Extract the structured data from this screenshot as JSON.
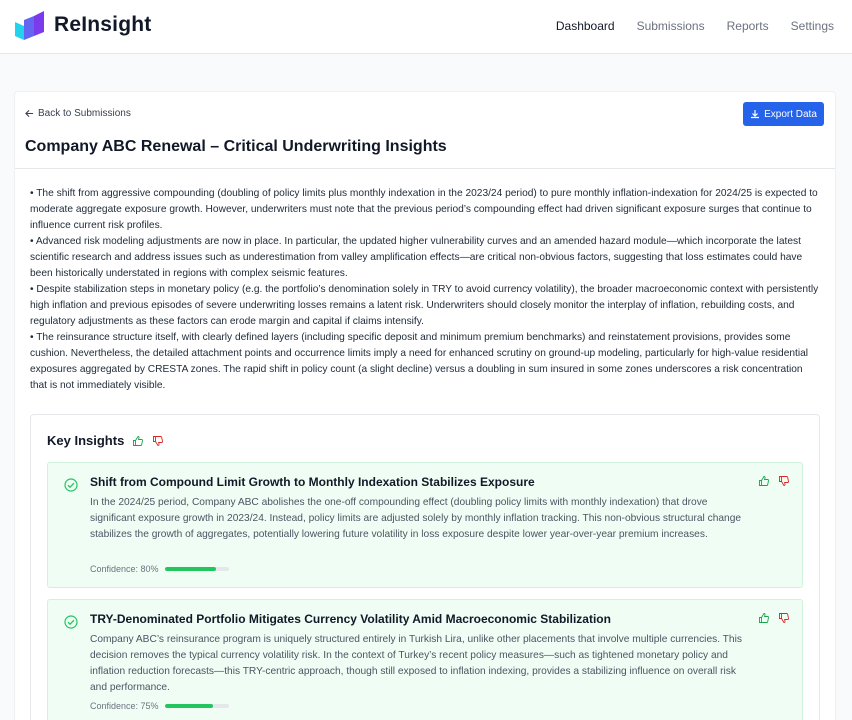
{
  "app": {
    "name": "ReInsight"
  },
  "nav": [
    {
      "label": "Dashboard",
      "active": true
    },
    {
      "label": "Submissions",
      "active": false
    },
    {
      "label": "Reports",
      "active": false
    },
    {
      "label": "Settings",
      "active": false
    }
  ],
  "header": {
    "back_label": "Back to Submissions",
    "export_label": "Export Data",
    "title": "Company ABC Renewal – Critical Underwriting Insights"
  },
  "summary": [
    "• The shift from aggressive compounding (doubling of policy limits plus monthly indexation in the 2023/24 period) to pure monthly inflation-indexation for 2024/25 is expected to moderate aggregate exposure growth. However, underwriters must note that the previous period’s compounding effect had driven significant exposure surges that continue to influence current risk profiles.",
    "• Advanced risk modeling adjustments are now in place. In particular, the updated higher vulnerability curves and an amended hazard module—which incorporate the latest scientific research and address issues such as underestimation from valley amplification effects—are critical non-obvious factors, suggesting that loss estimates could have been historically understated in regions with complex seismic features.",
    "• Despite stabilization steps in monetary policy (e.g. the portfolio’s denomination solely in TRY to avoid currency volatility), the broader macroeconomic context with persistently high inflation and previous episodes of severe underwriting losses remains a latent risk. Underwriters should closely monitor the interplay of inflation, rebuilding costs, and regulatory adjustments as these factors can erode margin and capital if claims intensify.",
    "• The reinsurance structure itself, with clearly defined layers (including specific deposit and minimum premium benchmarks) and reinstatement provisions, provides some cushion. Nevertheless, the detailed attachment points and occurrence limits imply a need for enhanced scrutiny on ground-up modeling, particularly for high-value residential exposures aggregated by CRESTA zones. The rapid shift in policy count (a slight decline) versus a doubling in sum insured in some zones underscores a risk concentration that is not immediately visible."
  ],
  "key_insights": {
    "title": "Key Insights",
    "items": [
      {
        "title": "Shift from Compound Limit Growth to Monthly Indexation Stabilizes Exposure",
        "body": "In the 2024/25 period, Company ABC abolishes the one-off compounding effect (doubling policy limits with monthly indexation) that drove significant exposure growth in 2023/24. Instead, policy limits are adjusted solely by monthly inflation tracking. This non-obvious structural change stabilizes the growth of aggregates, potentially lowering future volatility in loss exposure despite lower year-over-year premium increases.",
        "confidence_label": "Confidence: 80%",
        "confidence": 0.8
      },
      {
        "title": "TRY-Denominated Portfolio Mitigates Currency Volatility Amid Macroeconomic Stabilization",
        "body": "Company ABC’s reinsurance program is uniquely structured entirely in Turkish Lira, unlike other placements that involve multiple currencies. This decision removes the typical currency volatility risk. In the context of Turkey’s recent policy measures—such as tightened monetary policy and inflation reduction forecasts—this TRY-centric approach, though still exposed to inflation indexing, provides a stabilizing influence on overall risk and performance.",
        "confidence_label": "Confidence: 75%",
        "confidence": 0.75
      }
    ]
  },
  "colors": {
    "accent": "#2563eb",
    "success": "#22c55e",
    "card_bg": "#f0fdf4"
  }
}
